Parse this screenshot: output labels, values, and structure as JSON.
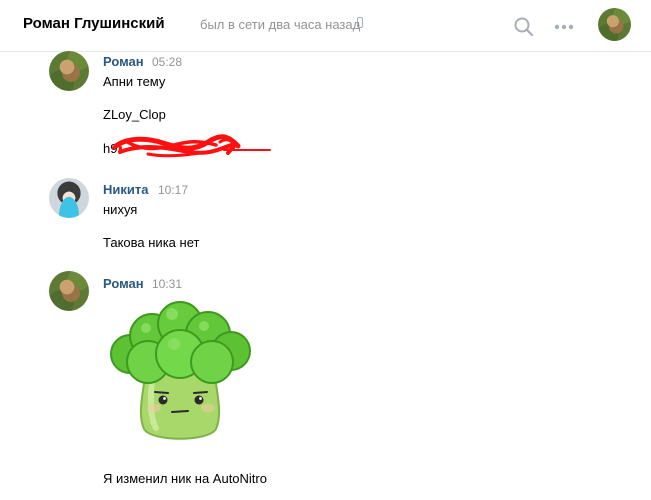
{
  "header": {
    "name": "Роман Глушинский",
    "status": "был в сети два часа назад"
  },
  "messages": [
    {
      "author": "Роман",
      "time": "05:28",
      "lines": [
        "Апни тему",
        "ZLoy_Clop",
        "h9"
      ]
    },
    {
      "author": "Никита",
      "time": "10:17",
      "lines": [
        "нихуя",
        "Такова ника нет"
      ]
    },
    {
      "author": "Роман",
      "time": "10:31",
      "lines": [
        "Я изменил ник на AutoNitro"
      ]
    }
  ],
  "icons": {
    "search": "search-icon",
    "more": "more-dots-icon",
    "phone": "mobile-phone-icon",
    "sticker": "broccoli-sticker"
  },
  "colors": {
    "author": "#2a5885",
    "meta": "#939393",
    "scribble": "#ff0000"
  }
}
